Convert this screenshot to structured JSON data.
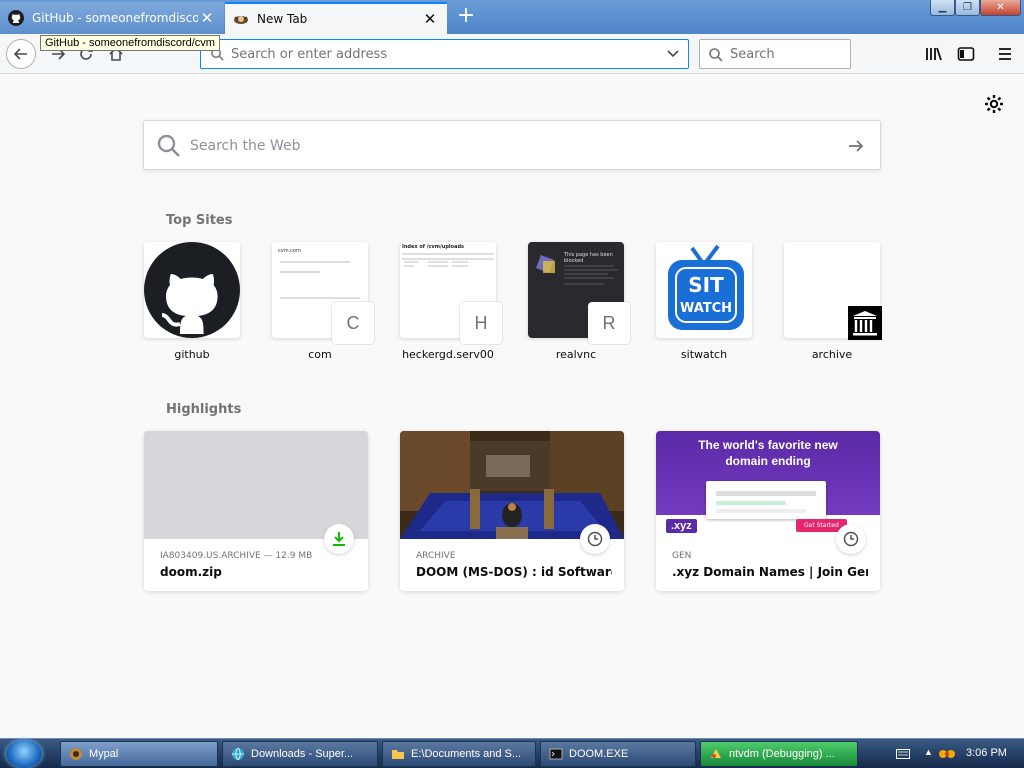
{
  "tabs": [
    {
      "title": "GitHub - someonefromdiscord",
      "icon": "github-icon"
    },
    {
      "title": "New Tab",
      "icon": "page-favicon-icon"
    }
  ],
  "tooltip": "GitHub - someonefromdiscord/cvm",
  "toolbar": {
    "url_placeholder": "Search or enter address",
    "search_placeholder": "Search"
  },
  "newtab": {
    "web_search_placeholder": "Search the Web",
    "top_sites_title": "Top Sites",
    "highlights_title": "Highlights",
    "top_sites": [
      {
        "label": "github",
        "letter": ""
      },
      {
        "label": "com",
        "letter": "C"
      },
      {
        "label": "heckergd.serv00",
        "letter": "H"
      },
      {
        "label": "realvnc",
        "letter": "R"
      },
      {
        "label": "sitwatch",
        "letter": ""
      },
      {
        "label": "archive",
        "letter": ""
      }
    ],
    "thumbs": {
      "com_heading": "cvm.com",
      "hecker_heading": "Index of /cvm/uploads",
      "realvnc_text": "This page has been blocked",
      "sitwatch_line1": "SIT",
      "sitwatch_line2": "WATCH"
    },
    "highlights": [
      {
        "source": "IA803409.US.ARCHIVE — 12.9 MB",
        "title": "doom.zip"
      },
      {
        "source": "ARCHIVE",
        "title": "DOOM (MS-DOS) : id Software : ..."
      },
      {
        "source": "GEN",
        "title": ".xyz Domain Names | Join Gener..."
      }
    ],
    "xyz_thumb": {
      "headline": "The world's favorite new domain ending",
      "badge": ".xyz",
      "button": "Get Started"
    }
  },
  "taskbar": {
    "items": [
      {
        "label": "Mypal"
      },
      {
        "label": "Downloads - Super..."
      },
      {
        "label": "E:\\Documents and S..."
      },
      {
        "label": "DOOM.EXE"
      },
      {
        "label": "ntvdm (Debugging) ..."
      }
    ],
    "clock": "3:06 PM"
  },
  "colors": {
    "accent": "#0a84ff",
    "download_green": "#12bc00",
    "xyz_purple": "#5a2aa8"
  }
}
